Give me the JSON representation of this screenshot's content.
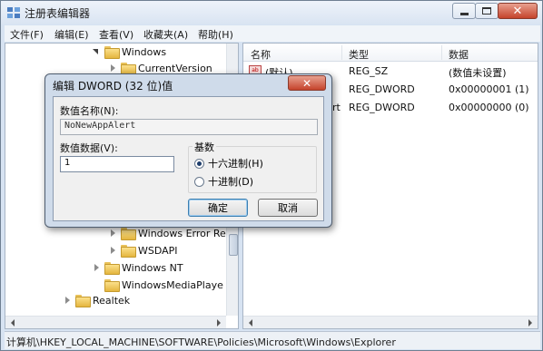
{
  "window": {
    "title": "注册表编辑器",
    "close_glyph": "✕"
  },
  "menu": [
    "文件(F)",
    "编辑(E)",
    "查看(V)",
    "收藏夹(A)",
    "帮助(H)"
  ],
  "tree": [
    {
      "label": "Windows",
      "expander": "expanded"
    },
    {
      "label": "CurrentVersion",
      "expander": "collapsed"
    },
    {
      "label": "Windows Error Re",
      "expander": "collapsed"
    },
    {
      "label": "WSDAPI",
      "expander": "collapsed"
    },
    {
      "label": "Windows NT",
      "expander": "collapsed"
    },
    {
      "label": "WindowsMediaPlaye",
      "expander": "none"
    },
    {
      "label": "Realtek",
      "expander": "collapsed"
    }
  ],
  "list": {
    "columns": [
      "名称",
      "类型",
      "数据"
    ],
    "rows": [
      {
        "name": "(默认)",
        "type": "REG_SZ",
        "data": "(数值未设置)"
      },
      {
        "name": "",
        "type": "REG_DWORD",
        "data": "0x00000001 (1)"
      },
      {
        "name": "rt",
        "type": "REG_DWORD",
        "data": "0x00000000 (0)"
      }
    ]
  },
  "status": {
    "path": "计算机\\HKEY_LOCAL_MACHINE\\SOFTWARE\\Policies\\Microsoft\\Windows\\Explorer"
  },
  "dialog": {
    "title": "编辑 DWORD (32 位)值",
    "close_glyph": "✕",
    "name_label": "数值名称(N):",
    "name_value": "NoNewAppAlert",
    "data_label": "数值数据(V):",
    "data_value": "1",
    "base_label": "基数",
    "base_options": [
      {
        "label": "十六进制(H)",
        "selected": true
      },
      {
        "label": "十进制(D)",
        "selected": false
      }
    ],
    "ok_label": "确定",
    "cancel_label": "取消"
  },
  "colors": {
    "titlebar": "#d9e4f2",
    "close_button": "#c5432b",
    "folder": "#e4b63f"
  }
}
